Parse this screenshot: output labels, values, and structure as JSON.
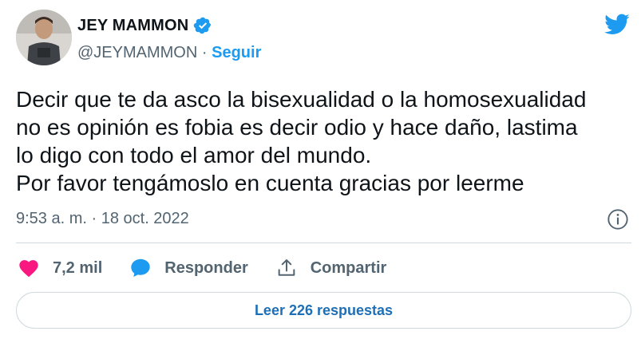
{
  "author": {
    "name": "JEY MAMMON",
    "handle": "@JEYMAMMON",
    "separator": "·",
    "follow_label": "Seguir"
  },
  "tweet": {
    "lines": [
      "Decir que te da asco la bisexualidad o la homosexualidad",
      "no es opinión es fobia es decir odio y hace daño, lastima",
      "lo digo con todo el amor del mundo.",
      "Por favor tengámoslo en cuenta gracias por leerme"
    ],
    "timestamp": "9:53 a. m. · 18 oct. 2022"
  },
  "actions": {
    "likes": "7,2 mil",
    "reply_label": "Responder",
    "share_label": "Compartir"
  },
  "replies_button": "Leer 226 respuestas",
  "icons": {
    "like": "heart-icon",
    "reply": "speech-bubble-icon",
    "share": "share-icon",
    "info": "info-icon",
    "brand": "twitter-bird-icon",
    "verified": "verified-badge-icon"
  },
  "colors": {
    "brand_blue": "#1d9bf0",
    "like_pink": "#f91880",
    "muted_text": "#536471",
    "link_blue": "#1d6fb8",
    "divider": "#cfd9de"
  }
}
